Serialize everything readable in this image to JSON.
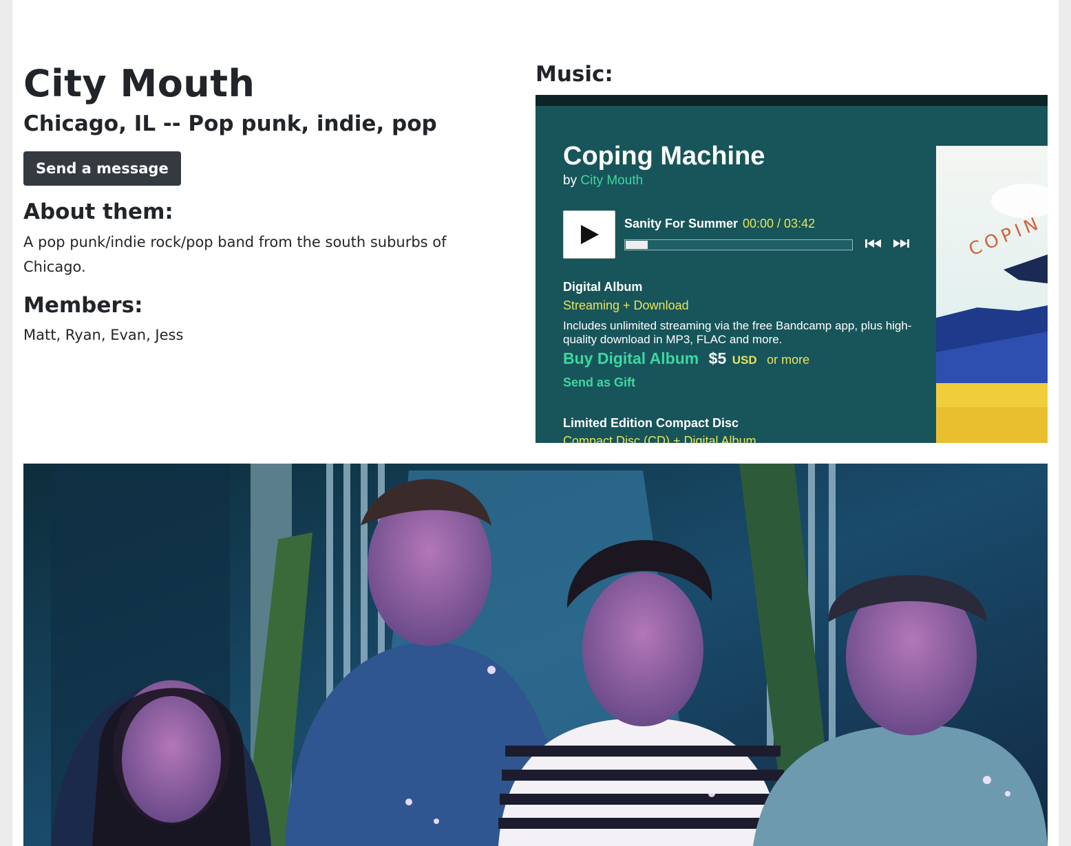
{
  "profile": {
    "name": "City Mouth",
    "subtitle": "Chicago, IL -- Pop punk, indie, pop",
    "message_button": "Send a message",
    "about_heading": "About them:",
    "about_text": "A pop punk/indie rock/pop band from the south suburbs of Chicago.",
    "members_heading": "Members:",
    "members_text": "Matt, Ryan, Evan, Jess"
  },
  "music": {
    "heading": "Music:",
    "player": {
      "album_title": "Coping Machine",
      "by_prefix": "by",
      "artist": "City Mouth",
      "track_name": "Sanity For Summer",
      "track_time": "00:00 / 03:42",
      "progress_fraction": 0,
      "digital_title": "Digital Album",
      "digital_type": "Streaming + Download",
      "digital_desc": "Includes unlimited streaming via the free Bandcamp app, plus high-quality download in MP3, FLAC and more.",
      "buy_label": "Buy Digital Album",
      "price": "$5",
      "currency": "USD",
      "or_more": "or more",
      "gift_label": "Send as Gift",
      "cd_title": "Limited Edition Compact Disc",
      "cd_type": "Compact Disc (CD) + Digital Album",
      "cover_text": "COPIN"
    }
  },
  "colors": {
    "player_bg": "#17555a",
    "link_green": "#3fd6a2",
    "accent_yellow": "#e9e45c",
    "button_dark": "#343a40"
  }
}
